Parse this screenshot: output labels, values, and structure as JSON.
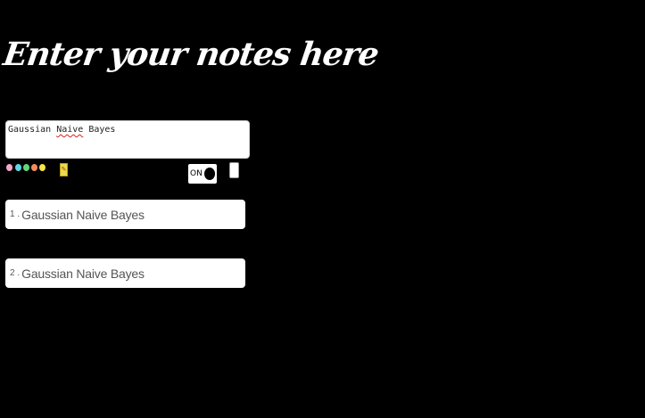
{
  "header": {
    "title": "Enter your notes here"
  },
  "input": {
    "value_before": "Gaussian ",
    "value_misspelled": "Naive",
    "value_after": " Bayes"
  },
  "colors": {
    "swatches": [
      {
        "name": "pink",
        "hex": "#f5a6c8"
      },
      {
        "name": "cyan",
        "hex": "#5fd6e0"
      },
      {
        "name": "green",
        "hex": "#5fd67a"
      },
      {
        "name": "orange",
        "hex": "#f58a5f"
      },
      {
        "name": "yellow",
        "hex": "#f7e54a"
      }
    ],
    "background": "#000000",
    "card": "#ffffff"
  },
  "toolbar": {
    "sticky_icon": "sticky-note-icon",
    "sticky_glyph": "✎",
    "toggle_label": "ON"
  },
  "notes": [
    {
      "index": "1 .",
      "text": "Gaussian Naive Bayes"
    },
    {
      "index": "2 .",
      "text": "Gaussian Naive Bayes"
    }
  ]
}
